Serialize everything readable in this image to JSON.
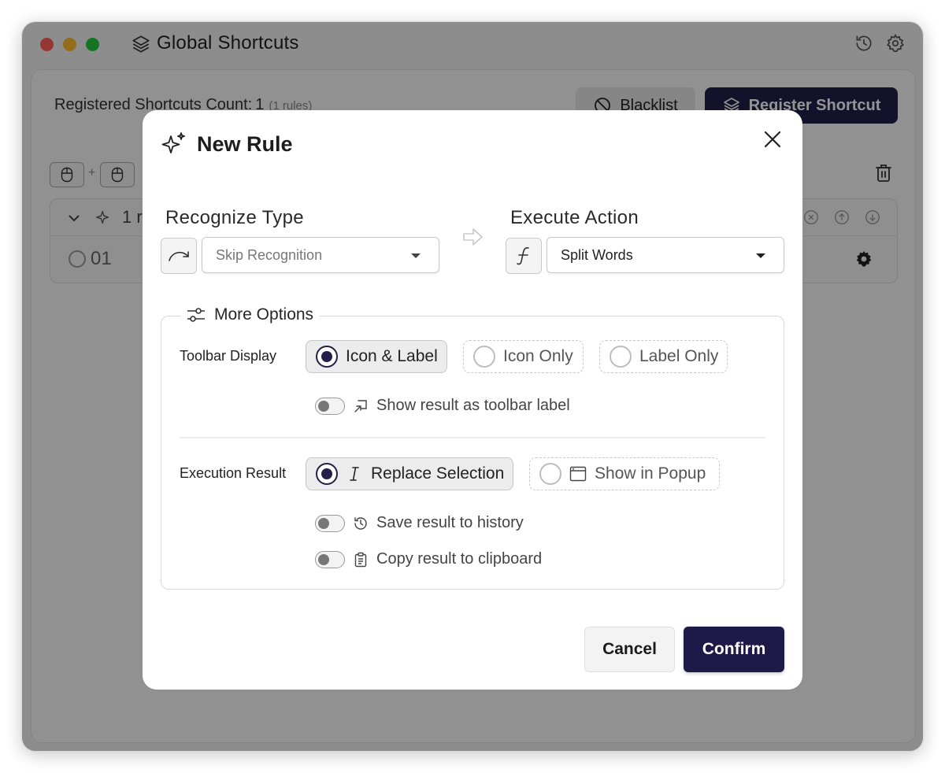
{
  "window": {
    "title": "Global Shortcuts"
  },
  "main": {
    "count_label": "Registered Shortcuts Count:",
    "count_value": "1",
    "count_sub": "(1 rules)",
    "blacklist_label": "Blacklist",
    "register_label": "Register Shortcut",
    "key_plus": "+",
    "rule_group_count": "1 r",
    "rule_row_index": "01"
  },
  "modal": {
    "title": "New Rule",
    "recognize": {
      "label": "Recognize Type",
      "value": "Skip Recognition"
    },
    "execute": {
      "label": "Execute Action",
      "value": "Split Words"
    },
    "more_options": {
      "label": "More Options",
      "toolbar_display": {
        "label": "Toolbar Display",
        "options": [
          "Icon & Label",
          "Icon Only",
          "Label Only"
        ],
        "selected": "Icon & Label"
      },
      "show_result_label": {
        "label": "Show result as toolbar label",
        "enabled": false
      },
      "execution_result": {
        "label": "Execution Result",
        "options": [
          "Replace Selection",
          "Show in Popup"
        ],
        "selected": "Replace Selection"
      },
      "save_history": {
        "label": "Save result to history",
        "enabled": false
      },
      "copy_clipboard": {
        "label": "Copy result to clipboard",
        "enabled": false
      }
    },
    "cancel_label": "Cancel",
    "confirm_label": "Confirm"
  },
  "colors": {
    "primary": "#22204a",
    "traffic_red": "#ff5f57",
    "traffic_yellow": "#febc2e",
    "traffic_green": "#28c840"
  },
  "icons": {
    "app": "layers-icon",
    "history": "history-icon",
    "settings": "gear-icon",
    "modal": "sparkle-icon",
    "close": "close-icon",
    "recognize": "curved-arrow-icon",
    "execute": "function-icon",
    "arrow": "arrow-right-icon",
    "more_options": "sliders-icon",
    "toolbar_label": "label-link-icon",
    "replace": "text-cursor-icon",
    "popup": "window-icon",
    "save": "history-icon",
    "copy": "clipboard-icon"
  }
}
